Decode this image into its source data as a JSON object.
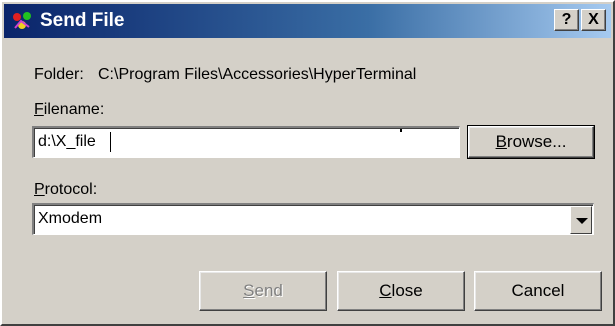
{
  "window": {
    "title": "Send File",
    "help_label": "?",
    "close_label": "X"
  },
  "folder": {
    "label": "Folder:",
    "path": "C:\\Program Files\\Accessories\\HyperTerminal"
  },
  "filename": {
    "label_accel": "F",
    "label_rest": "ilename:",
    "value": "d:\\X_file"
  },
  "browse_button": {
    "accel": "B",
    "rest": "rowse..."
  },
  "protocol": {
    "label_accel": "P",
    "label_rest": "rotocol:",
    "selected": "Xmodem"
  },
  "buttons": {
    "send": {
      "accel": "S",
      "rest": "end",
      "enabled": false
    },
    "close": {
      "accel": "C",
      "rest": "lose"
    },
    "cancel": {
      "label": "Cancel"
    }
  },
  "colors": {
    "title_gradient_start": "#0a246a",
    "title_gradient_end": "#a6caf0",
    "face": "#d4d0c8"
  }
}
